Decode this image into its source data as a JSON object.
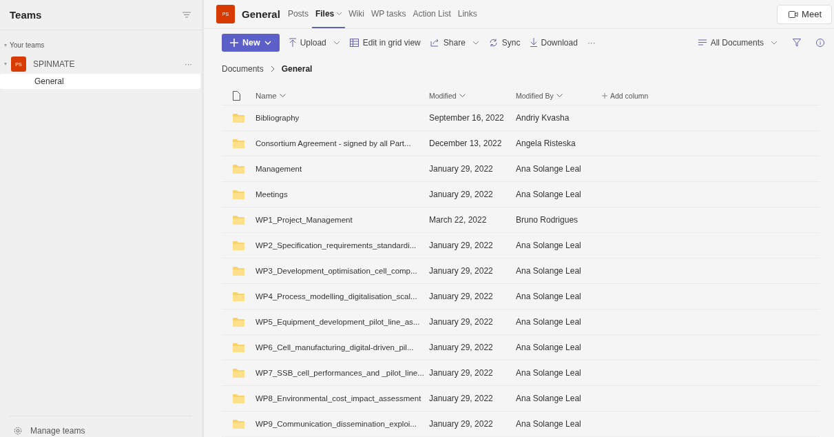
{
  "sidebar": {
    "title": "Teams",
    "section": "Your teams",
    "teams": [
      {
        "avatar": "PS",
        "name": "SPINMATE",
        "more": "···",
        "channels": [
          {
            "name": "General",
            "selected": true
          }
        ]
      }
    ],
    "manage": "Manage teams"
  },
  "header": {
    "avatar": "PS",
    "channel": "General",
    "tabs": [
      {
        "label": "Posts",
        "selected": false,
        "has_menu": false
      },
      {
        "label": "Files",
        "selected": true,
        "has_menu": true
      },
      {
        "label": "Wiki",
        "selected": false,
        "has_menu": false
      },
      {
        "label": "WP tasks",
        "selected": false,
        "has_menu": false
      },
      {
        "label": "Action List",
        "selected": false,
        "has_menu": false
      },
      {
        "label": "Links",
        "selected": false,
        "has_menu": false
      }
    ],
    "meet": "Meet"
  },
  "toolbar": {
    "new": "New",
    "items": [
      {
        "label": "Upload",
        "kind": "upload",
        "has_menu": true
      },
      {
        "label": "Edit in grid view",
        "kind": "grid",
        "has_menu": false
      },
      {
        "label": "Share",
        "kind": "share",
        "has_menu": true
      },
      {
        "label": "Sync",
        "kind": "sync",
        "has_menu": false
      },
      {
        "label": "Download",
        "kind": "download",
        "has_menu": false
      }
    ],
    "more": "···",
    "view": "All Documents"
  },
  "breadcrumb": [
    "Documents",
    "General"
  ],
  "table": {
    "columns": [
      "Name",
      "Modified",
      "Modified By"
    ],
    "add_column": "Add column",
    "rows": [
      {
        "name": "Bibliography",
        "modified": "September 16, 2022",
        "modified_by": "Andriy Kvasha"
      },
      {
        "name": "Consortium Agreement - signed by all Part...",
        "modified": "December 13, 2022",
        "modified_by": "Angela Risteska"
      },
      {
        "name": "Management",
        "modified": "January 29, 2022",
        "modified_by": "Ana Solange Leal"
      },
      {
        "name": "Meetings",
        "modified": "January 29, 2022",
        "modified_by": "Ana Solange Leal"
      },
      {
        "name": "WP1_Project_Management",
        "modified": "March 22, 2022",
        "modified_by": "Bruno Rodrigues"
      },
      {
        "name": "WP2_Specification_requirements_standardi...",
        "modified": "January 29, 2022",
        "modified_by": "Ana Solange Leal"
      },
      {
        "name": "WP3_Development_optimisation_cell_comp...",
        "modified": "January 29, 2022",
        "modified_by": "Ana Solange Leal"
      },
      {
        "name": "WP4_Process_modelling_digitalisation_scal...",
        "modified": "January 29, 2022",
        "modified_by": "Ana Solange Leal"
      },
      {
        "name": "WP5_Equipment_development_pilot_line_as...",
        "modified": "January 29, 2022",
        "modified_by": "Ana Solange Leal"
      },
      {
        "name": "WP6_Cell_manufacturing_digital-driven_pil...",
        "modified": "January 29, 2022",
        "modified_by": "Ana Solange Leal"
      },
      {
        "name": "WP7_SSB_cell_performances_and _pilot_line...",
        "modified": "January 29, 2022",
        "modified_by": "Ana Solange Leal"
      },
      {
        "name": "WP8_Environmental_cost_impact_assessment",
        "modified": "January 29, 2022",
        "modified_by": "Ana Solange Leal"
      },
      {
        "name": "WP9_Communication_dissemination_exploi...",
        "modified": "January 29, 2022",
        "modified_by": "Ana Solange Leal"
      }
    ]
  }
}
